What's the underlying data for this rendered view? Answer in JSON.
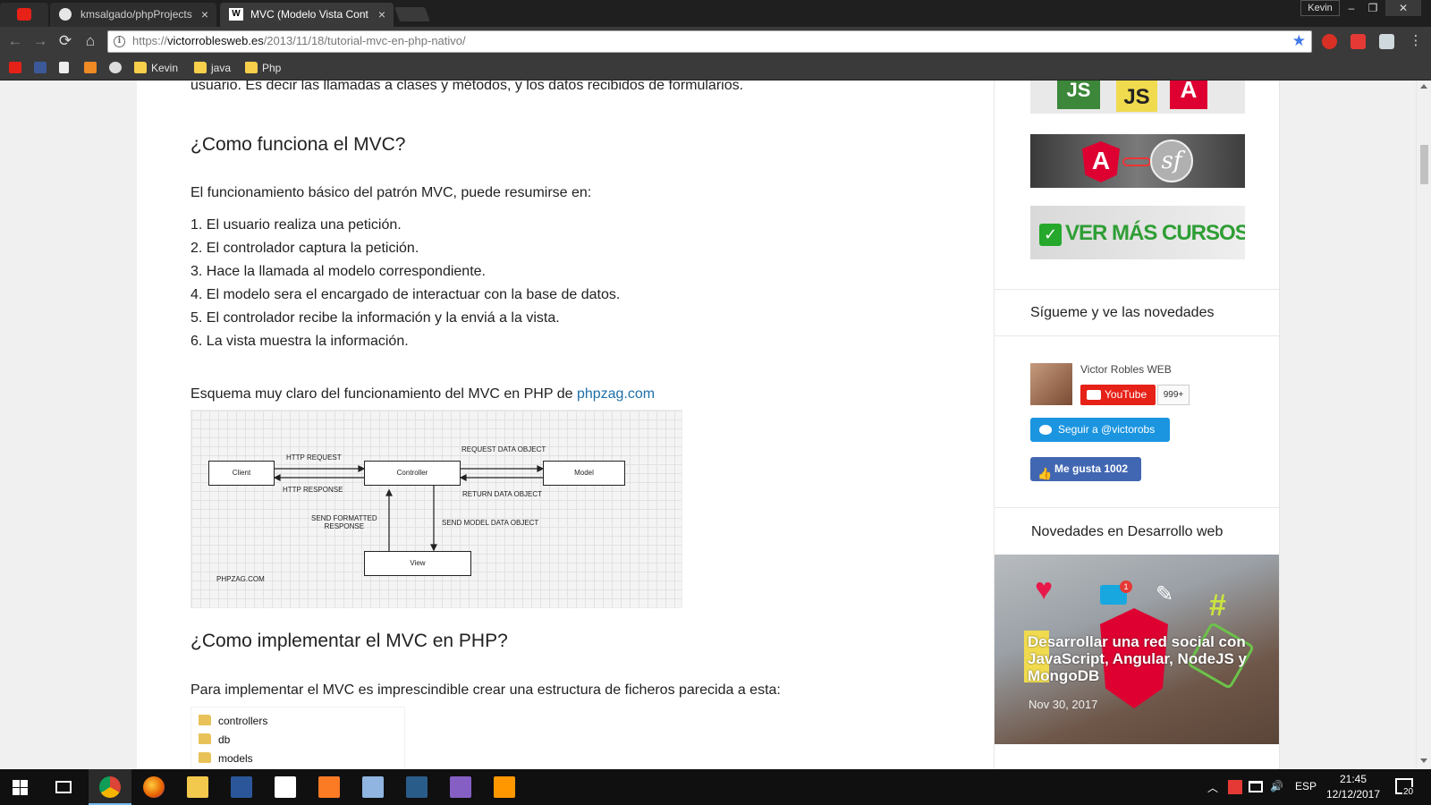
{
  "window": {
    "profile": "Kevin"
  },
  "tabs": [
    {
      "title": "",
      "icon": "youtube-icon"
    },
    {
      "title": "kmsalgado/phpProjects",
      "icon": "github-icon"
    },
    {
      "title": "MVC (Modelo Vista Cont",
      "icon": "vrw-icon"
    }
  ],
  "address": {
    "scheme": "https://",
    "host": "victorroblesweb.es",
    "path": "/2013/11/18/tutorial-mvc-en-php-nativo/"
  },
  "bookmarks": [
    {
      "label": "",
      "icon": "youtube-icon"
    },
    {
      "label": "",
      "icon": "facebook-icon"
    },
    {
      "label": "",
      "icon": "page-icon"
    },
    {
      "label": "",
      "icon": "3d-box-icon"
    },
    {
      "label": "",
      "icon": "github-icon"
    },
    {
      "label": "Kevin",
      "icon": "folder-icon"
    },
    {
      "label": "java",
      "icon": "folder-icon"
    },
    {
      "label": "Php",
      "icon": "folder-icon"
    }
  ],
  "article": {
    "top_line": "usuario. Es decir las llamadas a clases y métodos, y los datos recibidos de formularios.",
    "h_funciona": "¿Como funciona el MVC?",
    "intro": "El funcionamiento básico del patrón MVC, puede resumirse en:",
    "steps": [
      "El usuario realiza una petición.",
      "El controlador captura la petición.",
      "Hace la llamada al modelo correspondiente.",
      "El modelo sera el encargado de interactuar con la base de datos.",
      "El controlador recibe la información y la enviá a la vista.",
      "La vista muestra la información."
    ],
    "esquema_text": "Esquema muy claro del funcionamiento del MVC en PHP de ",
    "esquema_link": "phpzag.com",
    "diagram": {
      "client": "Client",
      "controller": "Controller",
      "model": "Model",
      "view": "View",
      "http_request": "HTTP REQUEST",
      "http_response": "HTTP RESPONSE",
      "request_data": "REQUEST DATA OBJECT",
      "return_data": "RETURN DATA OBJECT",
      "send_formatted_1": "SEND FORMATTED",
      "send_formatted_2": "RESPONSE",
      "send_model": "SEND MODEL DATA OBJECT",
      "credit": "PHPZAG.COM"
    },
    "h_implementar": "¿Como implementar el MVC en PHP?",
    "para_implementar": "Para implementar el MVC es imprescindible crear una estructura de ficheros parecida a esta:",
    "folders": [
      "controllers",
      "db",
      "models"
    ]
  },
  "sidebar": {
    "banner_js": {
      "js1": "JS",
      "js2": "JS",
      "a": "A"
    },
    "banner_ng_sf": {
      "a": "A",
      "sf": "sf"
    },
    "ver_mas": "VER MÁS CURSOS",
    "siguenos_title": "Sígueme y ve las novedades",
    "channel_name": "Victor Robles WEB",
    "youtube_label": "YouTube",
    "youtube_count": "999+",
    "twitter_label": "Seguir a @victorobs",
    "fb_label": "Me gusta 1002",
    "novedades_title": "Novedades en Desarrollo web",
    "post_title": "Desarrollar una red social con JavaScript, Angular, NodeJS y MongoDB",
    "post_date": "Nov 30, 2017",
    "post_badge": "1",
    "post_hash": "#"
  },
  "taskbar": {
    "lang": "ESP",
    "time": "21:45",
    "date": "12/12/2017",
    "notifications": "20"
  },
  "colors": {
    "accent_link": "#1e6fa8",
    "youtube": "#e62117",
    "twitter": "#1b95e0",
    "facebook": "#4267b2",
    "chrome_dark": "#3a3a3a"
  }
}
